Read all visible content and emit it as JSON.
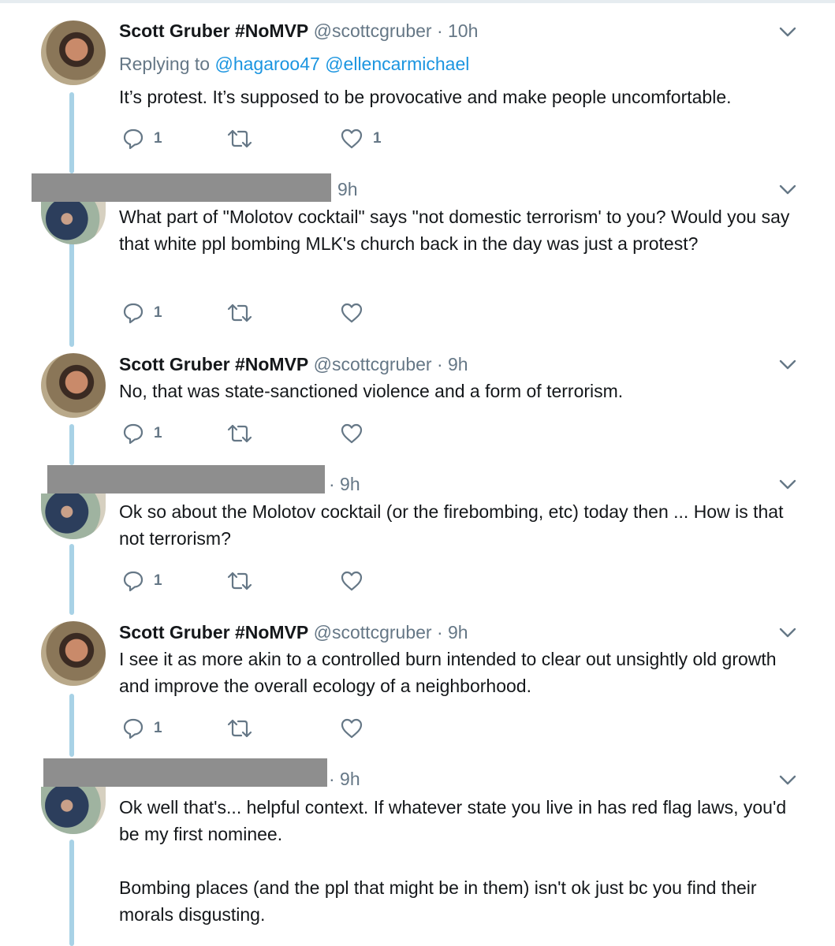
{
  "tweets": [
    {
      "name": "Scott Gruber #NoMVP",
      "handle": "@scottcgruber",
      "time": "· 10h",
      "reply_prefix": "Replying to ",
      "reply_handles": "@hagaroo47 @ellencarmichael",
      "text": "It’s protest. It’s supposed to be provocative and make people uncomfortable.",
      "reply_count": "1",
      "like_count": "1"
    },
    {
      "time": "9h",
      "text": "What part of \"Molotov cocktail\" says \"not domestic terrorism' to you? Would you say that white ppl bombing MLK's church back in the day was just a protest?",
      "reply_count": "1"
    },
    {
      "name": "Scott Gruber #NoMVP",
      "handle": "@scottcgruber",
      "time": "· 9h",
      "text": "No, that was state-sanctioned violence and a form of terrorism.",
      "reply_count": "1"
    },
    {
      "time": "· 9h",
      "text": "Ok so about the Molotov cocktail (or the firebombing, etc) today then ... How is that not terrorism?",
      "reply_count": "1"
    },
    {
      "name": "Scott Gruber #NoMVP",
      "handle": "@scottcgruber",
      "time": "· 9h",
      "text": "I see it as more akin to a controlled burn intended to clear out unsightly old growth and improve the overall ecology of a neighborhood.",
      "reply_count": "1"
    },
    {
      "time": "· 9h",
      "text1": "Ok well that's... helpful context. If whatever state you live in has red flag laws, you'd be my first nominee.",
      "text2": "Bombing places (and the ppl that might be in them) isn't ok just bc you find their morals disgusting."
    }
  ],
  "icons": {
    "reply": "reply-icon",
    "retweet": "retweet-icon",
    "like": "heart-icon",
    "more": "chevron-down-icon"
  },
  "colors": {
    "thread_line": "#a8d2e6",
    "link": "#1b95e0",
    "muted": "#657786",
    "redaction": "#8e8e8e"
  }
}
